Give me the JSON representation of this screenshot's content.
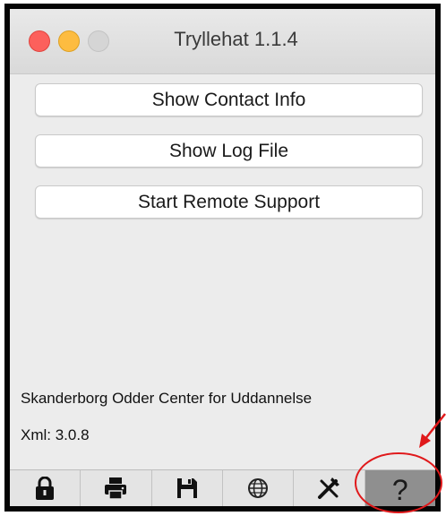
{
  "window": {
    "title": "Tryllehat 1.1.4"
  },
  "buttons": {
    "contact": "Show Contact Info",
    "log": "Show Log File",
    "remote": "Start Remote Support"
  },
  "info": {
    "organization": "Skanderborg Odder Center for Uddannelse",
    "xml_version": "Xml: 3.0.8"
  },
  "toolbar": {
    "items": [
      {
        "icon": "lock-icon"
      },
      {
        "icon": "printer-icon"
      },
      {
        "icon": "save-icon"
      },
      {
        "icon": "globe-icon"
      },
      {
        "icon": "tools-icon"
      },
      {
        "icon": "help-icon",
        "glyph": "?",
        "active": true
      }
    ]
  },
  "colors": {
    "close": "#fc605c",
    "minimize": "#fdbc40",
    "annotation": "#e0191b",
    "active_tab": "#8f8f8f"
  }
}
